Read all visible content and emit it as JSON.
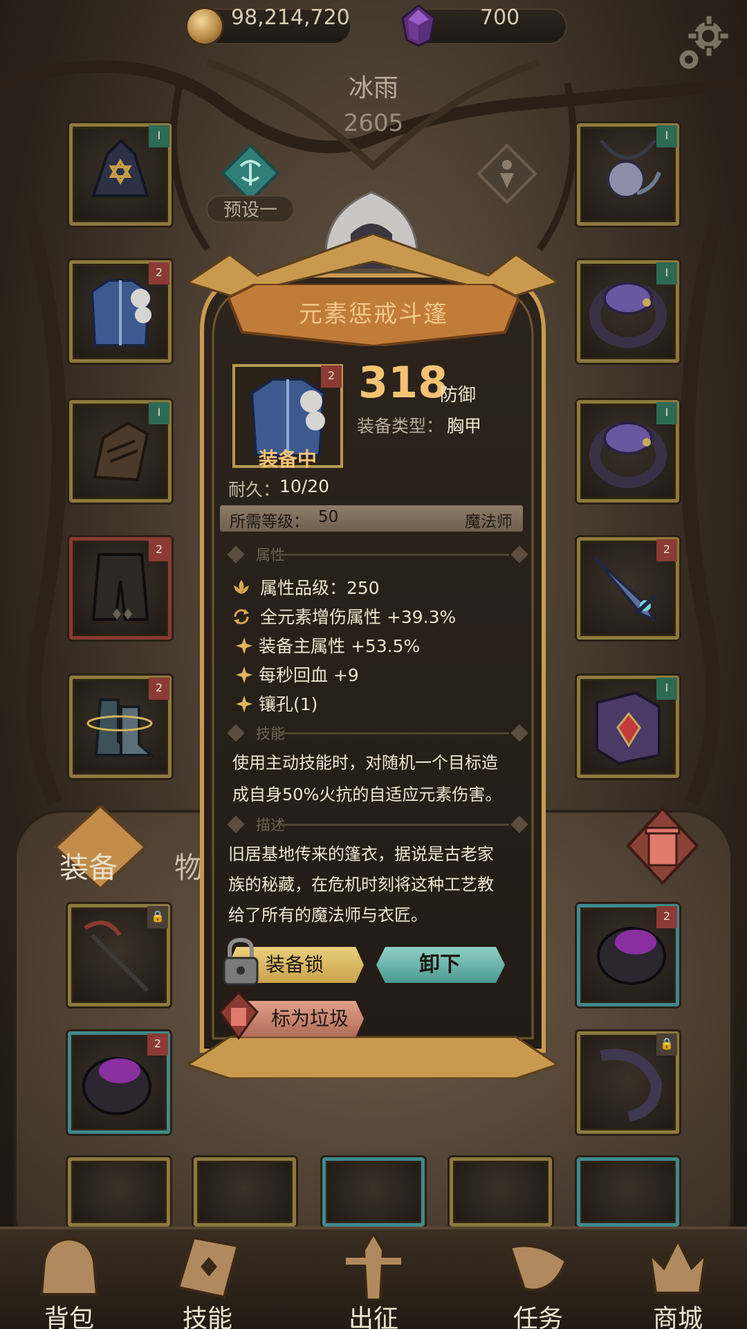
{
  "resources": {
    "gold": "98,214,720",
    "gems": "700"
  },
  "hero": {
    "name": "冰雨",
    "power": "2605",
    "preset_label": "预设一"
  },
  "slots": {
    "left": [
      {
        "icon": "helmet-icon",
        "tag": "I",
        "tag_color": "green"
      },
      {
        "icon": "armor-icon",
        "tag": "2",
        "tag_color": "red"
      },
      {
        "icon": "gloves-icon",
        "tag": "I",
        "tag_color": "green"
      },
      {
        "icon": "pants-icon",
        "tag": "2",
        "tag_color": "red"
      },
      {
        "icon": "boots-icon",
        "tag": "2",
        "tag_color": "red"
      }
    ],
    "right": [
      {
        "icon": "necklace-icon",
        "tag": "I",
        "tag_color": "green"
      },
      {
        "icon": "ring-icon",
        "tag": "I",
        "tag_color": "green"
      },
      {
        "icon": "ring-icon",
        "tag": "I",
        "tag_color": "green"
      },
      {
        "icon": "sword-icon",
        "tag": "2",
        "tag_color": "red"
      },
      {
        "icon": "spellbook-icon",
        "tag": "I",
        "tag_color": "green"
      }
    ]
  },
  "tabs": {
    "equip": "装备",
    "items": "物品"
  },
  "nav": [
    {
      "label": "背包",
      "icon": "bag-icon"
    },
    {
      "label": "技能",
      "icon": "skill-book-icon"
    },
    {
      "label": "出征",
      "icon": "battle-banner-icon"
    },
    {
      "label": "任务",
      "icon": "quest-horn-icon"
    },
    {
      "label": "商城",
      "icon": "shop-crown-icon"
    }
  ],
  "dialog": {
    "title": "元素惩戒斗篷",
    "item_tag": "2",
    "status": "装备中",
    "stat_value": "318",
    "stat_name": "防御",
    "type_label": "装备类型：",
    "type_value": "胸甲",
    "durability_label": "耐久：",
    "durability_value": "10/20",
    "level_label": "所需等级：",
    "level_value": "50",
    "class_value": "魔法师",
    "section_attr": "属性",
    "attributes": [
      {
        "icon": "lotus-icon",
        "text": "属性品级：250"
      },
      {
        "icon": "cycle-icon",
        "text": "全元素增伤属性 +39.3%"
      },
      {
        "icon": "sparkle-icon",
        "text": "装备主属性 +53.5%"
      },
      {
        "icon": "sparkle-icon",
        "text": "每秒回血 +9"
      },
      {
        "icon": "sparkle-icon",
        "text": "镶孔(1)"
      }
    ],
    "section_skill": "技能",
    "skill_lines": [
      "使用主动技能时，对随机一个目标造",
      "成自身50%火抗的自适应元素伤害。"
    ],
    "section_desc": "描述",
    "desc_lines": [
      "旧居基地传来的篷衣，据说是古老家",
      "族的秘藏，在危机时刻将这种工艺教",
      "给了所有的魔法师与衣匠。"
    ],
    "buttons": {
      "lock": "装备锁",
      "unequip": "卸下",
      "mark_trash": "标为垃圾"
    }
  },
  "colors": {
    "gold_text": "#f3c273",
    "slot_gold_border": "#8d7a3c",
    "tag_green": "#2d6a54",
    "tag_red": "#8c3a35"
  }
}
